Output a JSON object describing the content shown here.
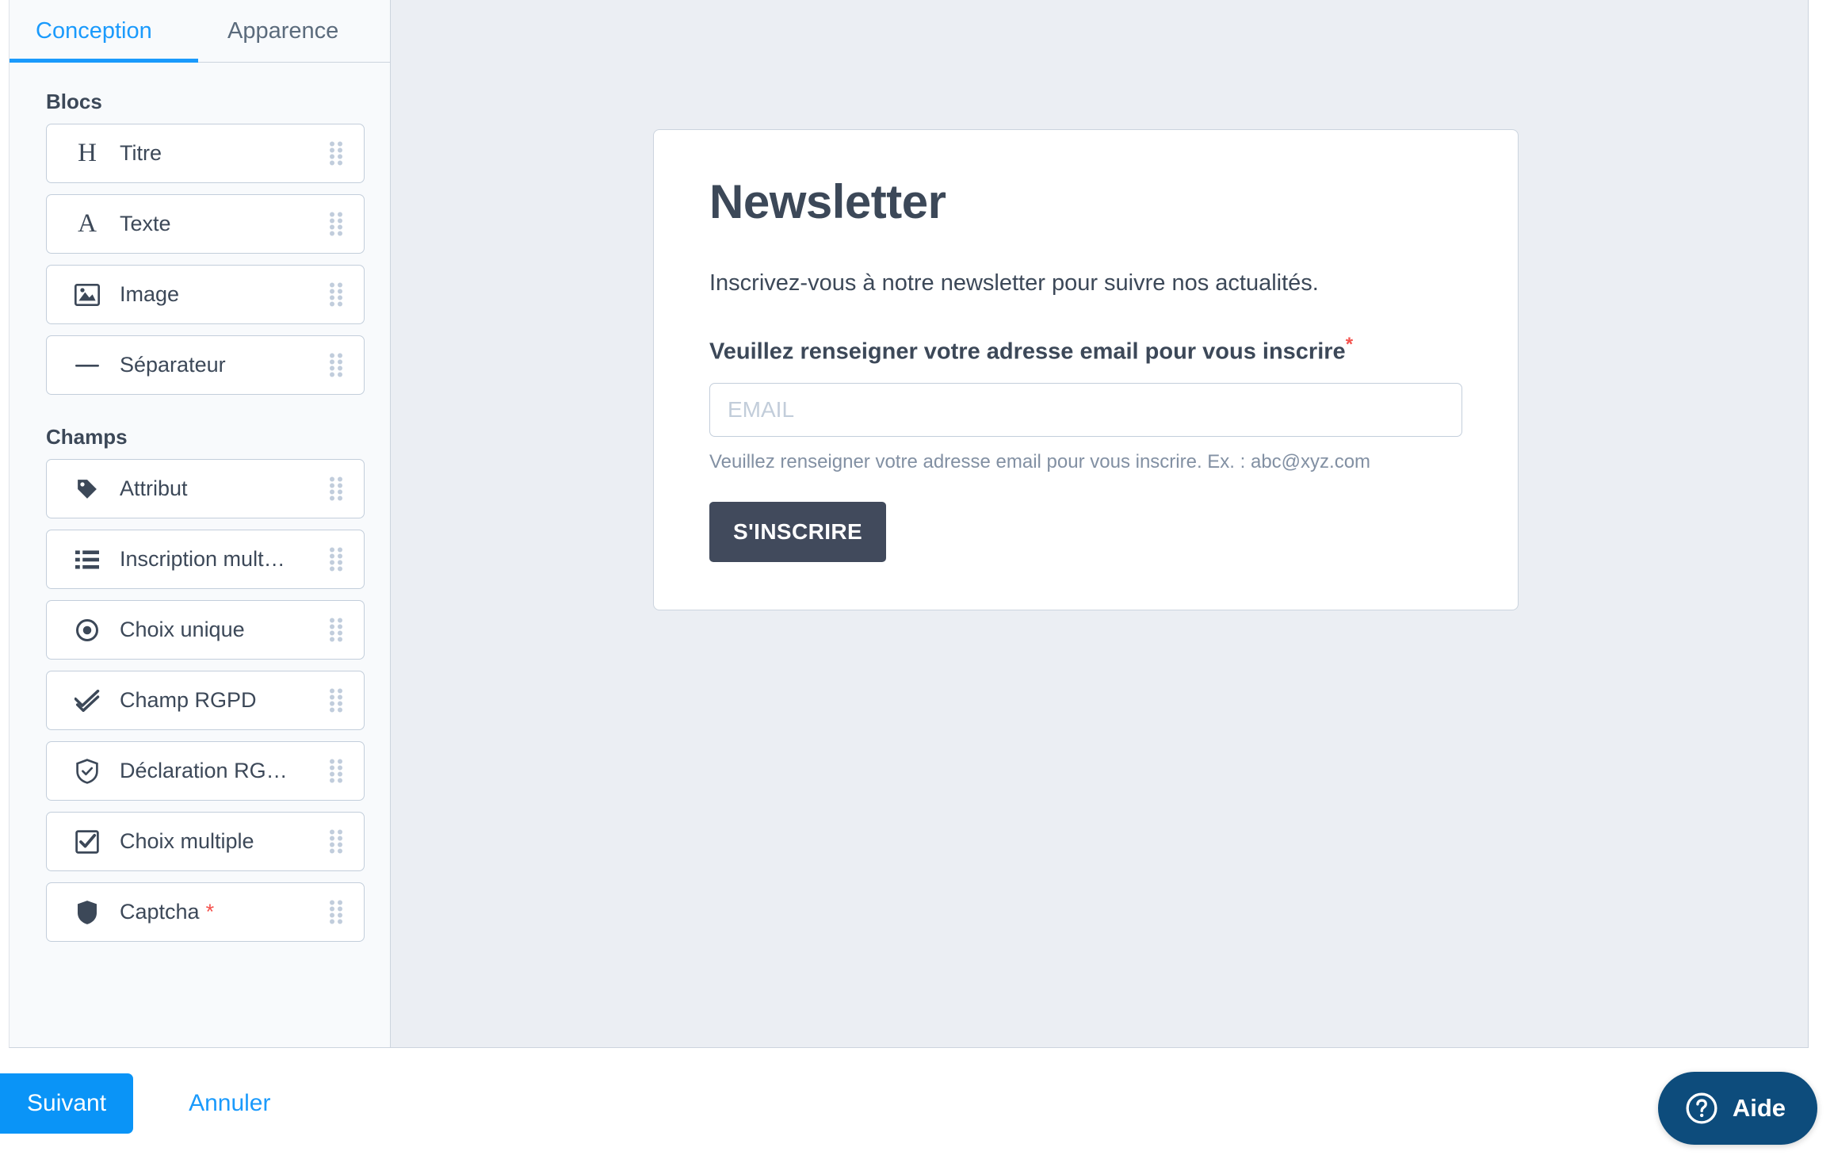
{
  "sidebar": {
    "tabs": [
      {
        "label": "Conception",
        "icon": "",
        "active": true
      },
      {
        "label": "Apparence",
        "icon": "",
        "active": false
      }
    ],
    "sections": [
      {
        "label": "Blocs",
        "items": [
          {
            "label": "Titre",
            "icon": "heading-glyph-icon",
            "glyph": "H",
            "required": ""
          },
          {
            "label": "Texte",
            "icon": "text-glyph-icon",
            "glyph": "A",
            "required": ""
          },
          {
            "label": "Image",
            "icon": "image-icon",
            "glyph": "",
            "required": ""
          },
          {
            "label": "Séparateur",
            "icon": "separator-icon",
            "glyph": "",
            "required": ""
          }
        ]
      },
      {
        "label": "Champs",
        "items": [
          {
            "label": "Attribut",
            "icon": "tag-icon",
            "glyph": "",
            "required": ""
          },
          {
            "label": "Inscription mult…",
            "icon": "list-icon",
            "glyph": "",
            "required": ""
          },
          {
            "label": "Choix unique",
            "icon": "radio-icon",
            "glyph": "",
            "required": ""
          },
          {
            "label": "Champ RGPD",
            "icon": "double-check-icon",
            "glyph": "",
            "required": ""
          },
          {
            "label": "Déclaration RG…",
            "icon": "shield-check-icon",
            "glyph": "",
            "required": ""
          },
          {
            "label": "Choix multiple",
            "icon": "checkbox-icon",
            "glyph": "",
            "required": ""
          },
          {
            "label": "Captcha",
            "icon": "shield-filled-icon",
            "glyph": "",
            "required": "*"
          }
        ]
      }
    ],
    "drag_handle_icon": "drag-handle-icon"
  },
  "canvas": {
    "form": {
      "title": "Newsletter",
      "description": "Inscrivez-vous à notre newsletter pour suivre nos actualités.",
      "field_label": "Veuillez renseigner votre adresse email pour vous inscrire",
      "field_required_mark": "*",
      "email_value": "",
      "email_placeholder": "EMAIL",
      "help_text": "Veuillez renseigner votre adresse email pour vous inscrire. Ex. : abc@xyz.com",
      "submit_label": "S'INSCRIRE"
    }
  },
  "footer": {
    "next_label": "Suivant",
    "cancel_label": "Annuler"
  },
  "help_widget": {
    "label": "Aide",
    "icon": "question-circle-icon"
  },
  "colors": {
    "accent_blue": "#1a9afc",
    "primary_button": "#0a94f7",
    "submit_button": "#414a5c",
    "required_red": "#f4524d",
    "help_widget": "#0d4c7c",
    "canvas_background": "#ebeef3",
    "sidebar_background": "#f8fafc",
    "text_dark": "#3c4858"
  }
}
